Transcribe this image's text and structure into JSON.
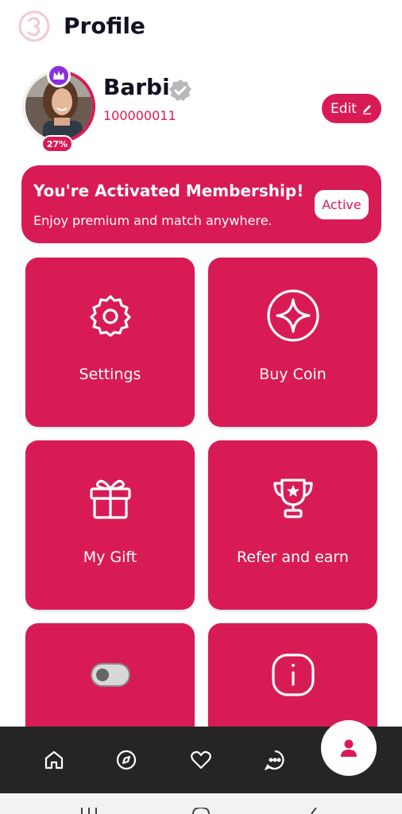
{
  "header": {
    "title": "Profile",
    "logo_icon": "brand-logo-icon"
  },
  "profile": {
    "name": "Barbi",
    "user_id": "100000011",
    "completion": "27%",
    "edit_label": "Edit"
  },
  "membership": {
    "title": "You're Activated Membership!",
    "subtitle": "Enjoy  premium and match anywhere.",
    "status_label": "Active"
  },
  "tiles": [
    {
      "label": "Settings",
      "icon": "gear-icon"
    },
    {
      "label": "Buy Coin",
      "icon": "sparkle-coin-icon"
    },
    {
      "label": "My Gift",
      "icon": "gift-icon"
    },
    {
      "label": "Refer and earn",
      "icon": "trophy-icon"
    },
    {
      "label": "",
      "icon": "toggle-icon"
    },
    {
      "label": "",
      "icon": "info-icon"
    }
  ],
  "bottom_nav": [
    "home-icon",
    "compass-icon",
    "heart-icon",
    "chat-icon",
    "profile-icon"
  ],
  "colors": {
    "accent": "#d81b55",
    "nav_bg": "#252525",
    "crown": "#8b2ee0"
  }
}
